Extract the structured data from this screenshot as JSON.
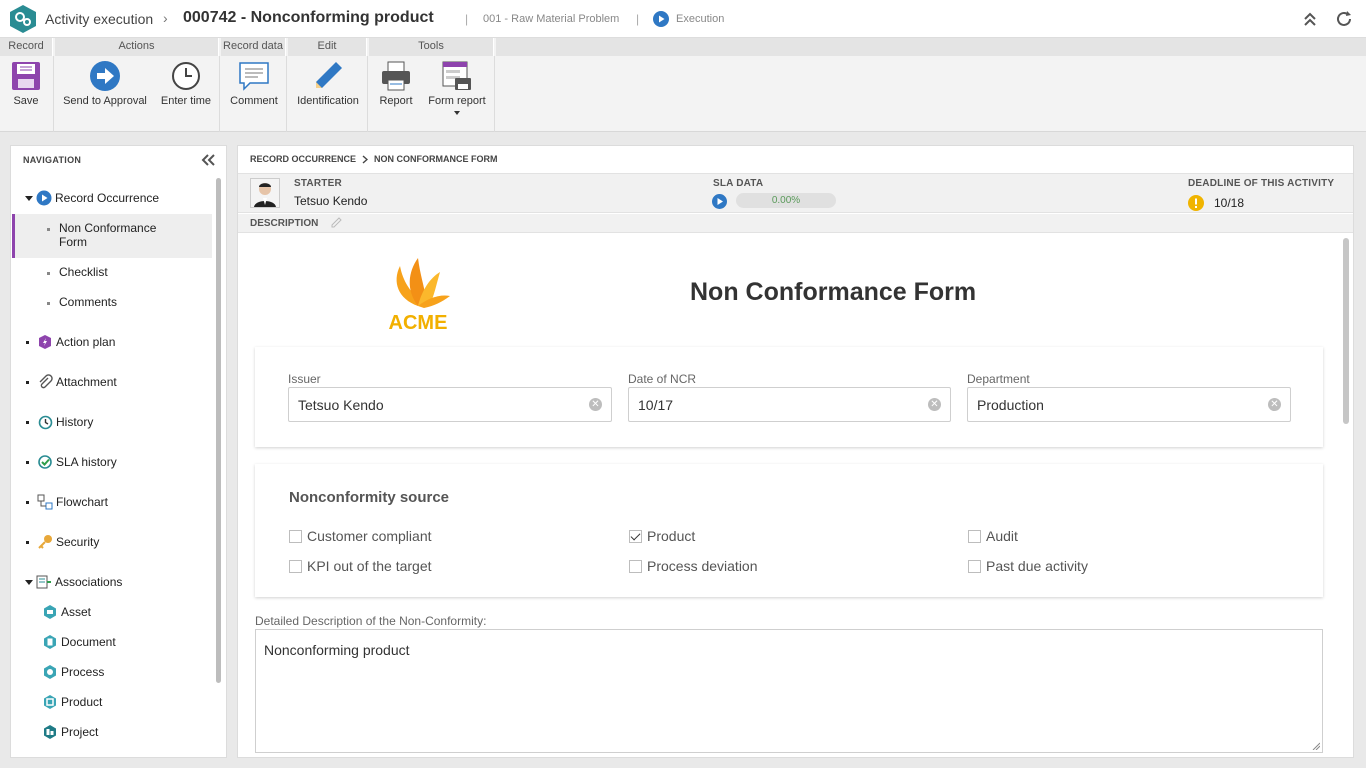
{
  "header": {
    "app_name": "Activity execution",
    "record_title": "000742 - Nonconforming product",
    "process_name": "001 - Raw Material Problem",
    "status": "Execution",
    "separator": "|"
  },
  "ribbon": {
    "groups": [
      "Record",
      "Actions",
      "Record data",
      "Edit",
      "Tools"
    ],
    "buttons": {
      "save": "Save",
      "send": "Send to Approval",
      "time": "Enter time",
      "comment": "Comment",
      "identification": "Identification",
      "report": "Report",
      "form_report": "Form report"
    }
  },
  "navigation": {
    "title": "NAVIGATION",
    "record_occurrence": "Record Occurrence",
    "non_conformance_form_line1": "Non Conformance",
    "non_conformance_form_line2": "Form",
    "checklist": "Checklist",
    "comments": "Comments",
    "action_plan": "Action plan",
    "attachment": "Attachment",
    "history": "History",
    "sla_history": "SLA history",
    "flowchart": "Flowchart",
    "security": "Security",
    "associations": "Associations",
    "asset": "Asset",
    "document": "Document",
    "process": "Process",
    "product": "Product",
    "project": "Project"
  },
  "main": {
    "crumb_1": "RECORD OCCURRENCE",
    "crumb_2": "NON CONFORMANCE FORM",
    "starter_label": "STARTER",
    "starter_name": "Tetsuo Kendo",
    "sla_label": "SLA DATA",
    "sla_progress": "0.00%",
    "deadline_label": "DEADLINE OF THIS ACTIVITY",
    "deadline_value": "10/18",
    "description_label": "DESCRIPTION"
  },
  "form": {
    "logo_text": "ACME",
    "title": "Non Conformance Form",
    "issuer_label": "Issuer",
    "issuer_value": "Tetsuo Kendo",
    "date_label": "Date of NCR",
    "date_value": "10/17",
    "department_label": "Department",
    "department_value": "Production",
    "source_title": "Nonconformity source",
    "sources": {
      "customer": "Customer compliant",
      "product": "Product",
      "audit": "Audit",
      "kpi": "KPI out of the target",
      "process": "Process deviation",
      "past_due": "Past due activity"
    },
    "checked": [
      "Product"
    ],
    "detail_label": "Detailed Description of the Non-Conformity:",
    "detail_value": "Nonconforming product"
  },
  "colors": {
    "accent_purple": "#8e44ad",
    "teal": "#2a8c93",
    "blue": "#2f78c4",
    "warning": "#f0b400"
  }
}
